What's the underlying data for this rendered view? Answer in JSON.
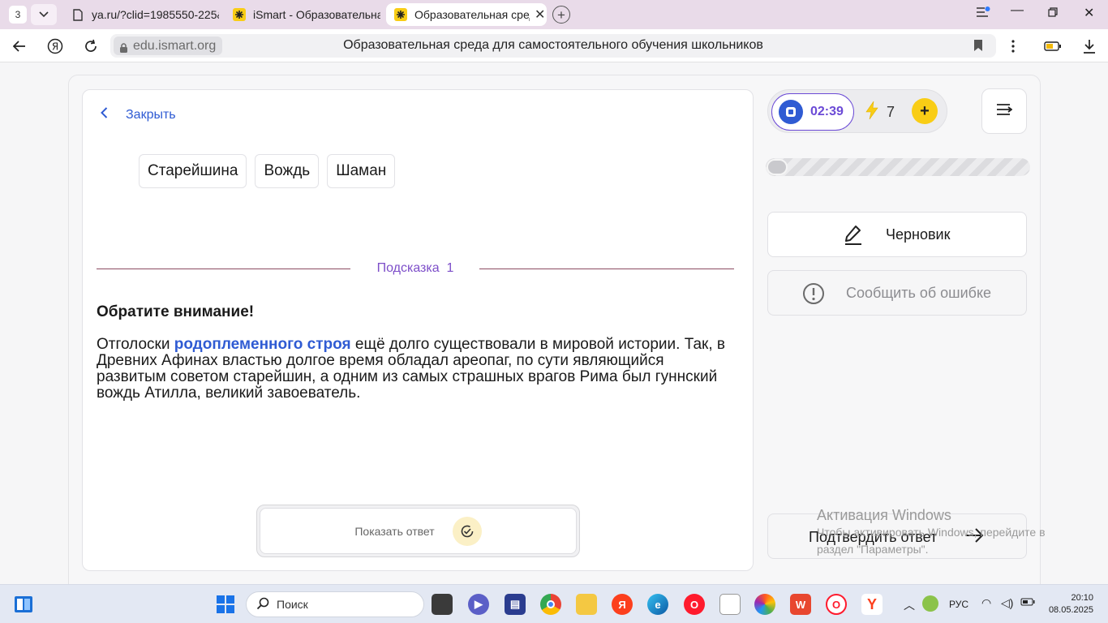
{
  "browser": {
    "tab_count": "3",
    "tabs": [
      {
        "title": "ya.ru/?clid=1985550-225&"
      },
      {
        "title": "iSmart - Образовательная"
      },
      {
        "title": "Образовательная сред"
      }
    ],
    "address": {
      "domain": "edu.ismart.org",
      "page_title": "Образовательная среда для самостоятельного обучения школьников"
    }
  },
  "task": {
    "close_label": "Закрыть",
    "word_chips": [
      "Старейшина",
      "Вождь",
      "Шаман"
    ],
    "hint_label": "Подсказка",
    "hint_number": "1",
    "hint_heading": "Обратите внимание!",
    "hint_text_before": "Отголоски ",
    "hint_text_highlight": "родоплеменного строя",
    "hint_text_after": " ещё долго существовали в мировой истории. Так, в Древних Афинах властью долгое время обладал ареопаг, по сути являющийся развитым советом старейшин, а одним из самых страшных врагов Рима был гуннский вождь Атилла, великий завоеватель.",
    "show_answer_label": "Показать ответ"
  },
  "sidebar": {
    "timer": "02:39",
    "energy": "7",
    "progress_fraction": 0.0,
    "draft_label": "Черновик",
    "report_label": "Сообщить об ошибке",
    "confirm_label": "Подтвердить ответ"
  },
  "watermark": {
    "line1": "Активация Windows",
    "line2": "Чтобы активировать Windows, перейдите в раздел \"Параметры\"."
  },
  "taskbar": {
    "search_label": "Поиск",
    "language": "РУС",
    "time": "20:10",
    "date": "08.05.2025"
  },
  "colors": {
    "accent_blue": "#2f5bd3",
    "accent_purple": "#6b4ad6",
    "energy_yellow": "#f9cd15",
    "hint_line": "#8c4b61"
  }
}
